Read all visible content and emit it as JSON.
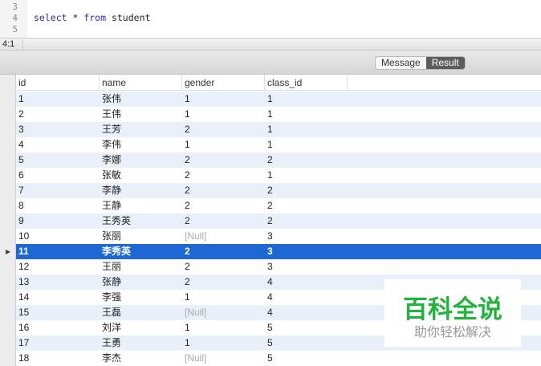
{
  "editor": {
    "line_numbers": [
      "3",
      "4",
      "5"
    ],
    "code_keyword1": "select",
    "code_op": " * ",
    "code_keyword2": "from",
    "code_table": " student"
  },
  "status": {
    "cursor": "4:1"
  },
  "tabs": {
    "message": "Message",
    "result": "Result",
    "active": "Result"
  },
  "table": {
    "columns": [
      "id",
      "name",
      "gender",
      "class_id"
    ],
    "selected_row": 11,
    "rows": [
      [
        "1",
        "张伟",
        "1",
        "1"
      ],
      [
        "2",
        "王伟",
        "1",
        "1"
      ],
      [
        "3",
        "王芳",
        "2",
        "1"
      ],
      [
        "4",
        "李伟",
        "1",
        "1"
      ],
      [
        "5",
        "李娜",
        "2",
        "2"
      ],
      [
        "6",
        "张敏",
        "2",
        "1"
      ],
      [
        "7",
        "李静",
        "2",
        "2"
      ],
      [
        "8",
        "王静",
        "2",
        "2"
      ],
      [
        "9",
        "王秀英",
        "2",
        "2"
      ],
      [
        "10",
        "张丽",
        "[Null]",
        "3"
      ],
      [
        "11",
        "李秀英",
        "2",
        "3"
      ],
      [
        "12",
        "王丽",
        "2",
        "3"
      ],
      [
        "13",
        "张静",
        "2",
        "4"
      ],
      [
        "14",
        "李强",
        "1",
        "4"
      ],
      [
        "15",
        "王磊",
        "[Null]",
        "4"
      ],
      [
        "16",
        "刘洋",
        "1",
        "5"
      ],
      [
        "17",
        "王勇",
        "1",
        "5"
      ],
      [
        "18",
        "李杰",
        "[Null]",
        "5"
      ]
    ]
  },
  "watermark": {
    "title": "百科全说",
    "subtitle": "助你轻松解决"
  },
  "colors": {
    "selection": "#1d68d2",
    "stripe": "#eaf0fa",
    "watermark": "#21b33b"
  }
}
